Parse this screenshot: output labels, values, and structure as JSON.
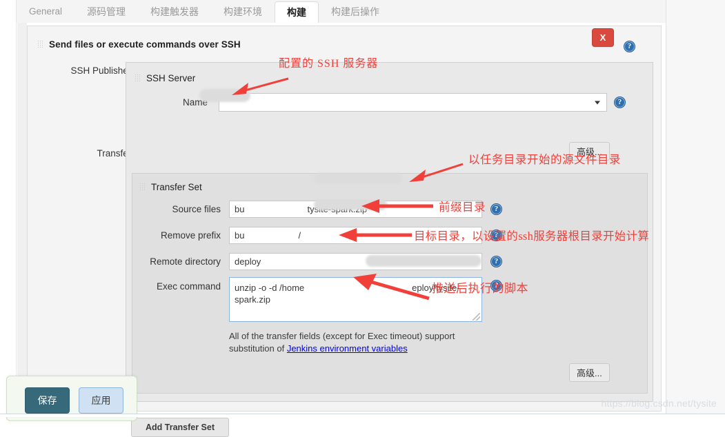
{
  "tabs": [
    {
      "label": "General",
      "active": false
    },
    {
      "label": "源码管理",
      "active": false
    },
    {
      "label": "构建触发器",
      "active": false
    },
    {
      "label": "构建环境",
      "active": false
    },
    {
      "label": "构建",
      "active": true
    },
    {
      "label": "构建后操作",
      "active": false
    }
  ],
  "block": {
    "title": "Send files or execute commands over SSH",
    "close_label": "X",
    "help_glyph": "?"
  },
  "labels": {
    "ssh_publishers": "SSH Publishers",
    "transfers": "Transfers"
  },
  "ssh_server": {
    "title": "SSH Server",
    "name_label": "Name",
    "name_value": "",
    "advanced_label": "高级..."
  },
  "transfer_set": {
    "title": "Transfer Set",
    "fields": [
      {
        "label": "Source files",
        "value": "bu       tysite-spark.zip"
      },
      {
        "label": "Remove prefix",
        "value": "bu      /"
      },
      {
        "label": "Remote directory",
        "value": "deploy"
      }
    ],
    "exec_label": "Exec command",
    "exec_value": "unzip -o -d /home            eploy/tysite-spark.zip",
    "note_line1": "All of the transfer fields (except for Exec timeout) support",
    "note_line2_prefix": "substitution of ",
    "note_link": "Jenkins environment variables",
    "advanced_label": "高级...",
    "add_transfer_set": "Add Transfer Set"
  },
  "annotations": [
    {
      "id": "ssh-server",
      "text": "配置的  SSH  服务器"
    },
    {
      "id": "source-files",
      "text": "以任务目录开始的源文件目录"
    },
    {
      "id": "remove-prefix",
      "text": "前缀目录"
    },
    {
      "id": "remote-dir",
      "text": "目标目录，以设置的ssh服务器根目录开始计算"
    },
    {
      "id": "exec-command",
      "text": "推送后执行的脚本"
    }
  ],
  "footer": {
    "save_label": "保存",
    "apply_label": "应用"
  },
  "watermark": "https://blog.csdn.net/tysite",
  "colors": {
    "accent_red": "#f1403a",
    "close_button": "#d9493d",
    "save_button": "#36697a",
    "apply_button": "#cfe1f3",
    "help_icon": "#2f6fb0",
    "link": "#5b4a8c"
  }
}
